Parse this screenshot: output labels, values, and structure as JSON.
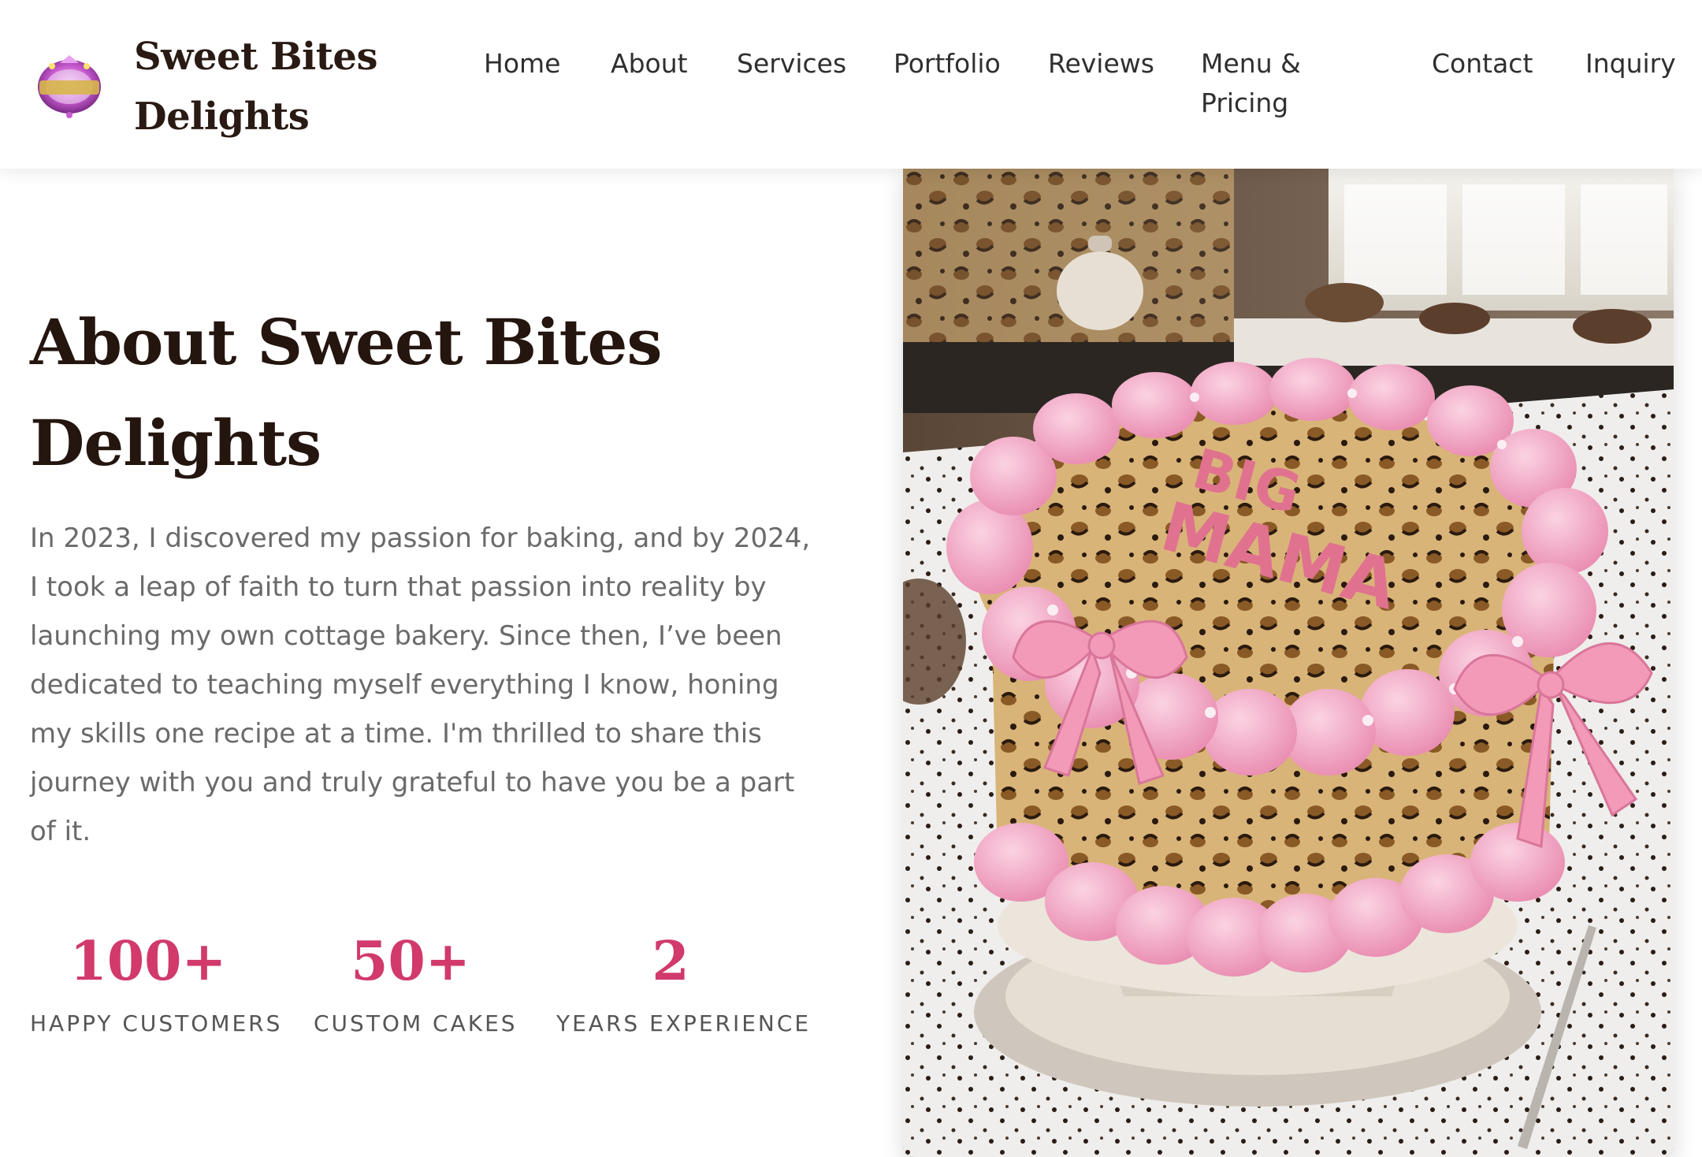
{
  "header": {
    "brand_name": "Sweet Bites Delights",
    "logo_alt": "Sweet Bites Delights logo",
    "nav": [
      {
        "label": "Home"
      },
      {
        "label": "About"
      },
      {
        "label": "Services"
      },
      {
        "label": "Portfolio"
      },
      {
        "label": "Reviews"
      },
      {
        "label": "Menu & Pricing"
      },
      {
        "label": "Contact"
      },
      {
        "label": "Inquiry"
      }
    ]
  },
  "about": {
    "title": "About Sweet Bites Delights",
    "body": "In 2023, I discovered my passion for baking, and by 2024, I took a leap of faith to turn that passion into reality by launching my own cottage bakery. Since then, I’ve been dedicated to teaching myself everything I know, honing my skills one recipe at a time. I'm thrilled to share this journey with you and truly grateful to have you be a part of it.",
    "stats": [
      {
        "value": "100+",
        "label": "HAPPY CUSTOMERS"
      },
      {
        "value": "50+",
        "label": "CUSTOM CAKES"
      },
      {
        "value": "2",
        "label": "YEARS EXPERIENCE"
      }
    ]
  },
  "image": {
    "cake_text": "BIG MAMA"
  },
  "colors": {
    "accent": "#d13a6b",
    "heading": "#24150f",
    "body_text": "#6a6a6a",
    "frosting": "#f2a3c1",
    "leopard_base": "#d9b478"
  }
}
